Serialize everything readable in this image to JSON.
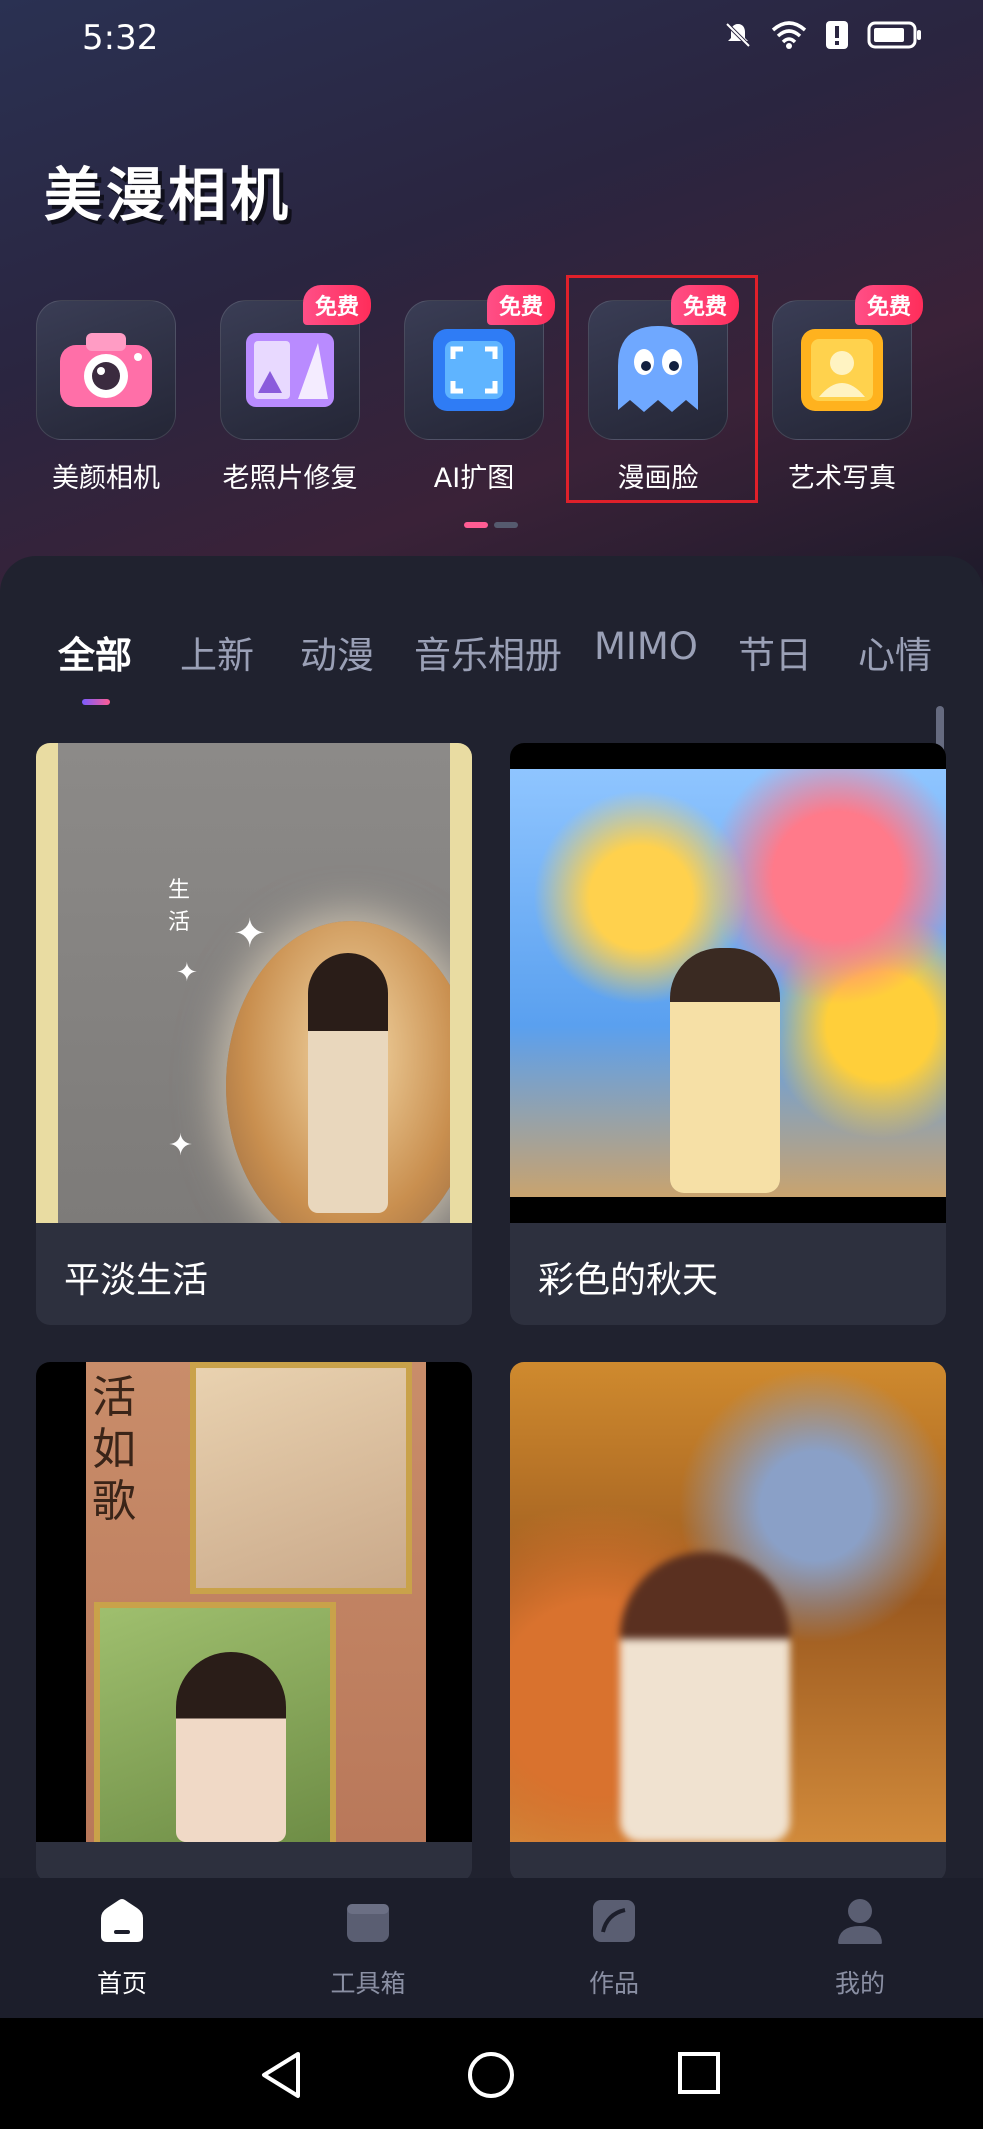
{
  "status": {
    "time": "5:32",
    "icons": [
      "mute-icon",
      "wifi-icon",
      "alert-icon",
      "battery-icon"
    ]
  },
  "app": {
    "title": "美漫相机"
  },
  "tools": [
    {
      "label": "美颜相机",
      "badge": "",
      "icon": "camera-icon"
    },
    {
      "label": "老照片修复",
      "badge": "免费",
      "icon": "photo-restore-icon"
    },
    {
      "label": "AI扩图",
      "badge": "免费",
      "icon": "expand-icon"
    },
    {
      "label": "漫画脸",
      "badge": "免费",
      "icon": "ghost-icon"
    },
    {
      "label": "艺术写真",
      "badge": "免费",
      "icon": "portrait-icon"
    }
  ],
  "categories": [
    "全部",
    "上新",
    "动漫",
    "音乐相册",
    "MIMO",
    "节日",
    "心情"
  ],
  "active_category": "全部",
  "cards": [
    {
      "title": "平淡生活",
      "overlay": "生活"
    },
    {
      "title": "彩色的秋天"
    },
    {
      "title": "",
      "overlay": "活如歌"
    },
    {
      "title": ""
    }
  ],
  "bottom_nav": [
    {
      "label": "首页",
      "icon": "home-icon",
      "active": true
    },
    {
      "label": "工具箱",
      "icon": "toolbox-icon",
      "active": false
    },
    {
      "label": "作品",
      "icon": "works-icon",
      "active": false
    },
    {
      "label": "我的",
      "icon": "profile-icon",
      "active": false
    }
  ],
  "colors": {
    "accent": "#ff5c93",
    "badge": "#ff2d5a",
    "highlight": "#e0202a",
    "panel": "#20222f"
  }
}
